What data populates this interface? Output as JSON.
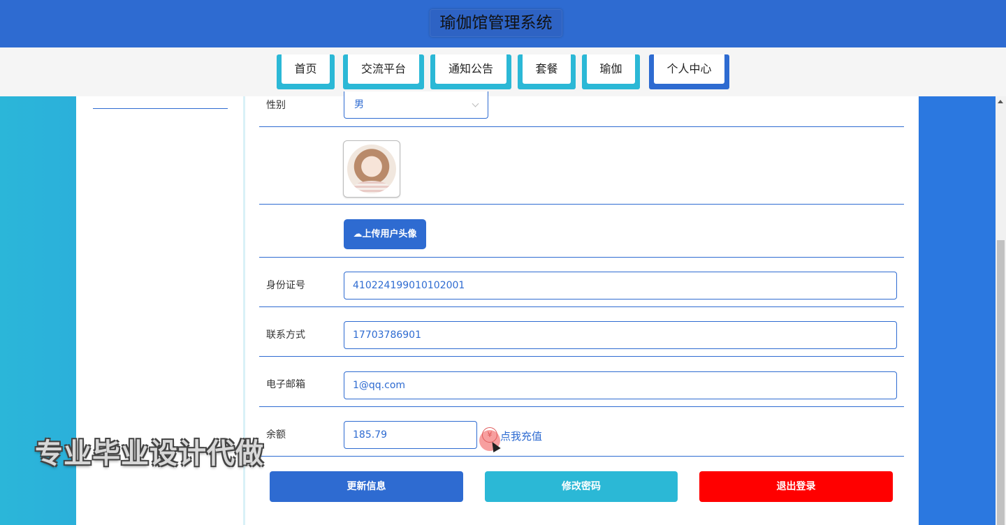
{
  "header": {
    "title": "瑜伽馆管理系统"
  },
  "nav": [
    {
      "label": "首页",
      "active": false
    },
    {
      "label": "交流平台",
      "active": false
    },
    {
      "label": "通知公告",
      "active": false
    },
    {
      "label": "套餐",
      "active": false
    },
    {
      "label": "瑜伽",
      "active": false
    },
    {
      "label": "个人中心",
      "active": true
    }
  ],
  "form": {
    "gender": {
      "label": "性别",
      "value": "男"
    },
    "avatar": {
      "icon": "user-avatar-image"
    },
    "upload": {
      "label": "上传用户头像",
      "icon": "cloud-upload-icon"
    },
    "id_card": {
      "label": "身份证号",
      "value": "410224199010102001"
    },
    "phone": {
      "label": "联系方式",
      "value": "17703786901"
    },
    "email": {
      "label": "电子邮箱",
      "value": "1@qq.com"
    },
    "balance": {
      "label": "余额",
      "value": "185.79",
      "recharge_label": "点我充值",
      "currency_symbol": "¥"
    }
  },
  "actions": {
    "update": "更新信息",
    "change_password": "修改密码",
    "logout": "退出登录"
  },
  "watermark": "专业毕业设计代做",
  "colors": {
    "primary": "#2e6bd1",
    "secondary": "#2bb8d6",
    "danger": "#ff0000"
  }
}
